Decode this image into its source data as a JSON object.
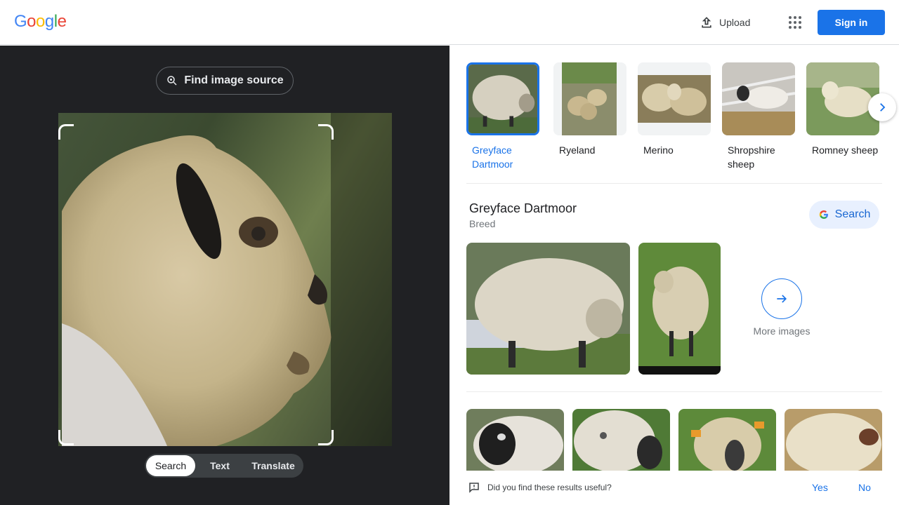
{
  "header": {
    "logo": {
      "G": "G",
      "o1": "o",
      "o2": "o",
      "g": "g",
      "l": "l",
      "e": "e"
    },
    "upload_label": "Upload",
    "apps_icon": "apps-grid-icon",
    "signin_label": "Sign in"
  },
  "left": {
    "find_source_label": "Find image source",
    "modes": [
      "Search",
      "Text",
      "Translate"
    ],
    "active_mode": "Search"
  },
  "results": {
    "related": [
      {
        "label": "Greyface Dartmoor",
        "selected": true
      },
      {
        "label": "Ryeland",
        "selected": false
      },
      {
        "label": "Merino",
        "selected": false
      },
      {
        "label": "Shropshire sheep",
        "selected": false
      },
      {
        "label": "Romney sheep",
        "selected": false
      }
    ],
    "entity": {
      "title": "Greyface Dartmoor",
      "subtitle": "Breed",
      "search_label": "Search"
    },
    "more_images_label": "More images",
    "feedback": {
      "question": "Did you find these results useful?",
      "yes": "Yes",
      "no": "No"
    }
  },
  "colors": {
    "accent": "#1a73e8",
    "left_panel_bg": "#202124"
  }
}
